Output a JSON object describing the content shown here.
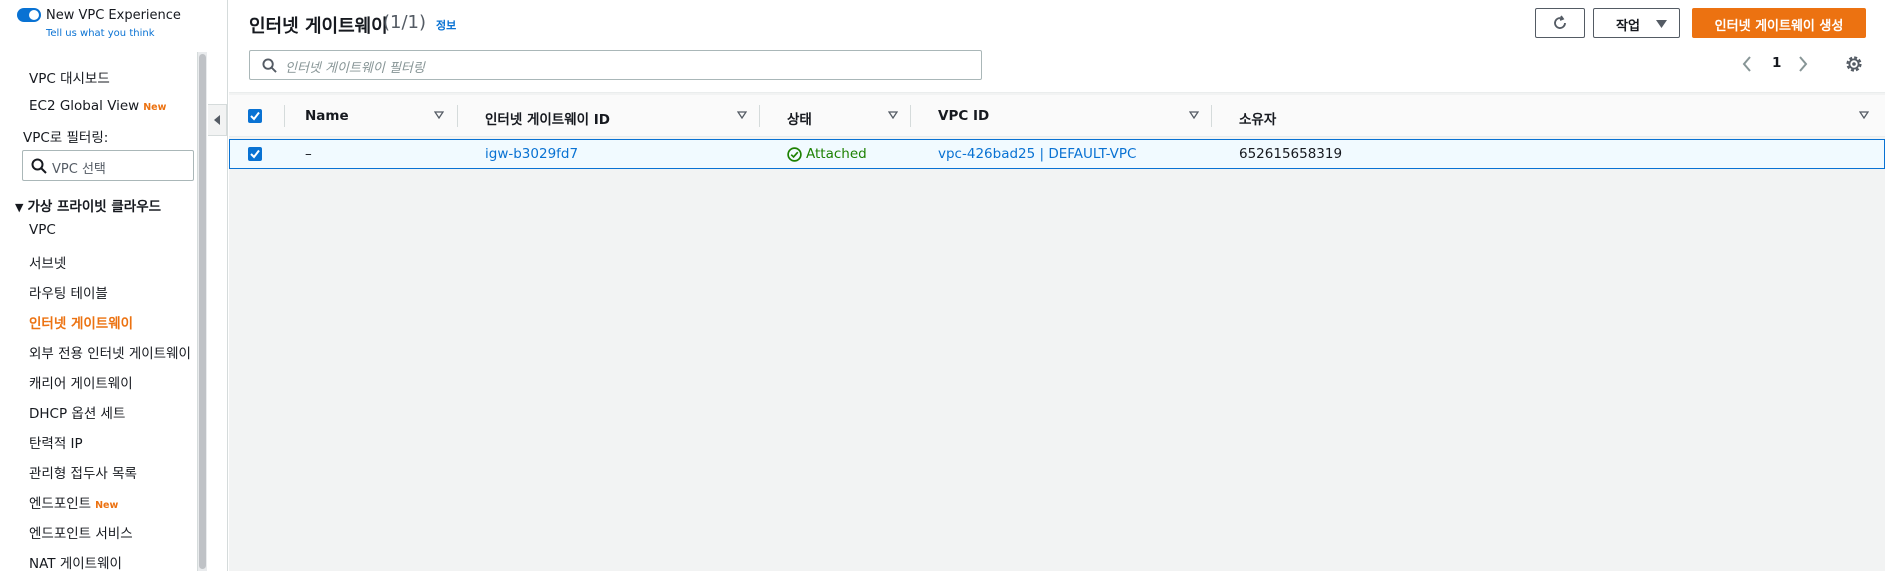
{
  "sidebar": {
    "toggle_label": "New VPC Experience",
    "tell_us": "Tell us what you think",
    "top_links": [
      {
        "label": "VPC 대시보드"
      },
      {
        "label": "EC2 Global View",
        "badge": "New"
      }
    ],
    "filter_label": "VPC로 필터링:",
    "vpc_select_placeholder": "VPC 선택",
    "section_title": "가상 프라이빗 클라우드",
    "items": [
      {
        "label": "VPC"
      },
      {
        "label": "서브넷"
      },
      {
        "label": "라우팅 테이블"
      },
      {
        "label": "인터넷 게이트웨이",
        "active": true
      },
      {
        "label": "외부 전용 인터넷 게이트웨이"
      },
      {
        "label": "캐리어 게이트웨이"
      },
      {
        "label": "DHCP 옵션 세트"
      },
      {
        "label": "탄력적 IP"
      },
      {
        "label": "관리형 접두사 목록"
      },
      {
        "label": "엔드포인트",
        "badge": "New"
      },
      {
        "label": "엔드포인트 서비스"
      },
      {
        "label": "NAT 게이트웨이"
      }
    ]
  },
  "header": {
    "title": "인터넷 게이트웨이",
    "count": "(1/1)",
    "info": "정보",
    "actions_label": "작업",
    "create_label": "인터넷 게이트웨이 생성",
    "filter_placeholder": "인터넷 게이트웨이 필터링",
    "page_number": "1"
  },
  "table": {
    "columns": [
      "Name",
      "인터넷 게이트웨이 ID",
      "상태",
      "VPC ID",
      "소유자"
    ],
    "rows": [
      {
        "name": "–",
        "id": "igw-b3029fd7",
        "status": "Attached",
        "vpc_id": "vpc-426bad25 | DEFAULT-VPC",
        "owner": "652615658319",
        "selected": true
      }
    ]
  },
  "colors": {
    "accent": "#ec7211",
    "link": "#0972d3",
    "success": "#1d8102"
  }
}
